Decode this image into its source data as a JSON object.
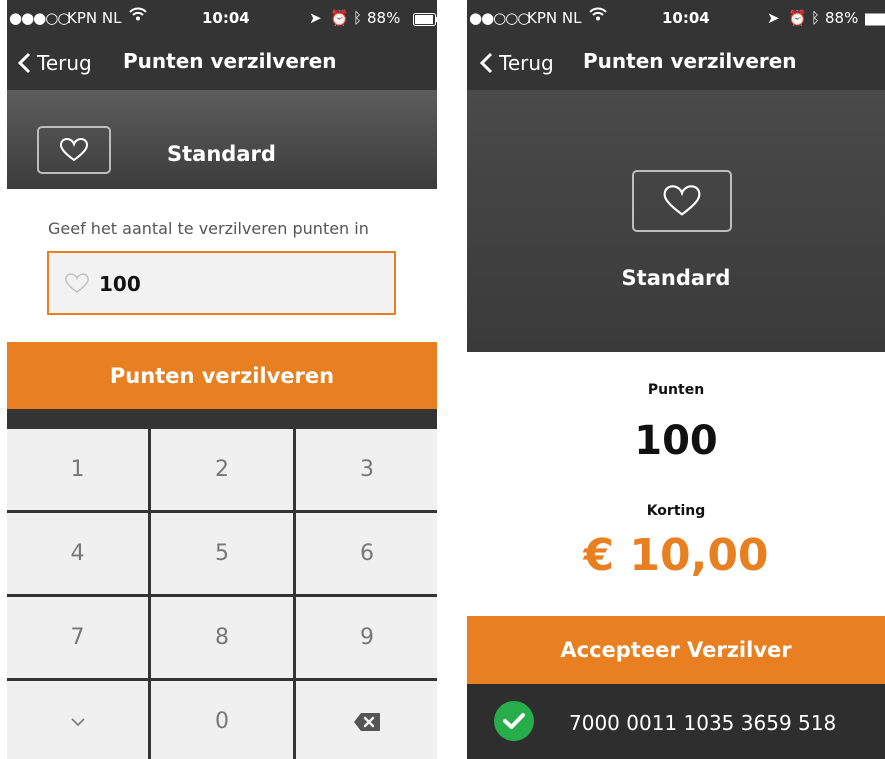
{
  "colors": {
    "accent": "#e87f21",
    "dark": "#343434",
    "success": "#27ae4a"
  },
  "left": {
    "status": {
      "carrier": "KPN NL",
      "time": "10:04",
      "battery": "88%"
    },
    "nav": {
      "back_label": "Terug",
      "title": "Punten verzilveren"
    },
    "card": {
      "name": "Standard"
    },
    "prompt": "Geef het aantal te verzilveren punten in",
    "input": {
      "value": "100"
    },
    "redeem_button": "Punten verzilveren",
    "keypad": {
      "keys": [
        "1",
        "2",
        "3",
        "4",
        "5",
        "6",
        "7",
        "8",
        "9",
        "",
        "0",
        ""
      ],
      "icons": {
        "9": "chevron-down-icon",
        "11": "backspace-icon"
      }
    }
  },
  "right": {
    "status": {
      "carrier": "KPN NL",
      "time": "10:04",
      "battery": "88%"
    },
    "nav": {
      "back_label": "Terug",
      "title": "Punten verzilveren"
    },
    "card": {
      "name": "Standard"
    },
    "points": {
      "label": "Punten",
      "value": "100"
    },
    "discount": {
      "label": "Korting",
      "value": "€ 10,00"
    },
    "accept_button": "Accepteer Verzilver",
    "card_number": "7000 0011 1035 3659 518"
  }
}
